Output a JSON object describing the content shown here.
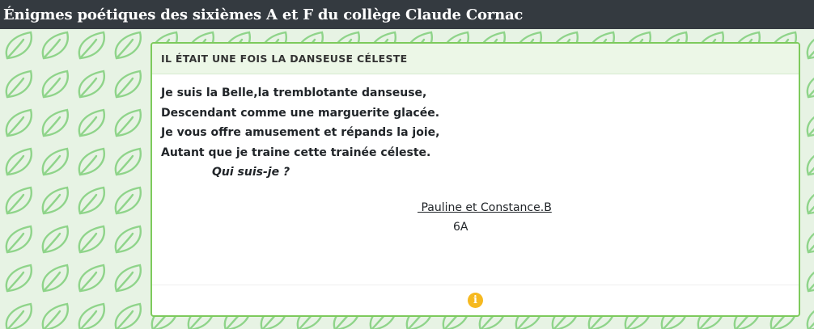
{
  "header": {
    "title": "Énigmes poétiques des sixièmes A et F du collège Claude Cornac"
  },
  "card": {
    "title": "IL ÉTAIT UNE FOIS LA DANSEUSE CÉLESTE",
    "poem_lines": [
      "Je suis la Belle,la tremblotante danseuse,",
      "Descendant comme une marguerite glacée.",
      "Je vous offre amusement et répands la joie,",
      "Autant que je traine cette trainée céleste."
    ],
    "question": "Qui suis-je ?",
    "author": " Pauline et Constance.B",
    "author_class": "6A",
    "footer_icon": "info-icon"
  },
  "colors": {
    "topbar": "#343a40",
    "page_background": "#e7f3e4",
    "leaf_pattern": "#8fd48a",
    "card_border": "#7dca5c",
    "info_icon": "#f6b920"
  }
}
